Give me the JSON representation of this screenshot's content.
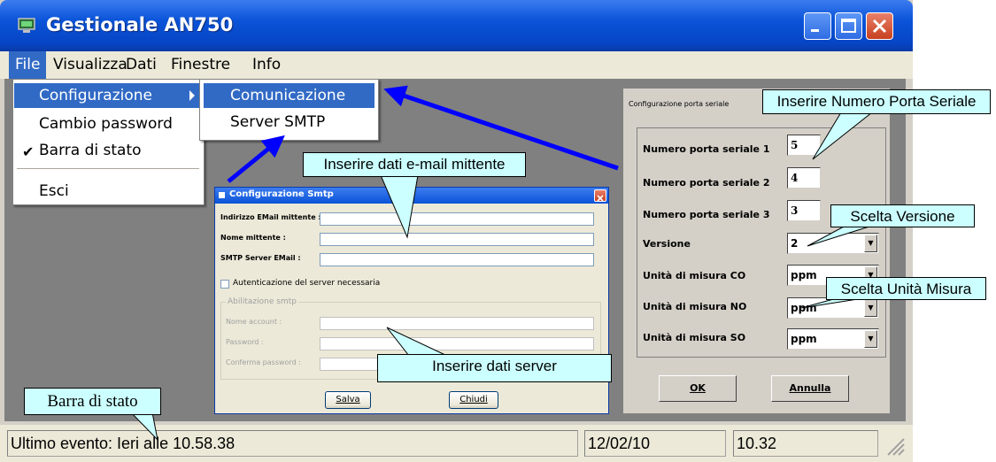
{
  "window": {
    "title": "Gestionale AN750"
  },
  "menubar": {
    "items": [
      "File",
      "Visualizza",
      "Dati",
      "Finestre",
      "Info"
    ]
  },
  "file_menu": {
    "items": [
      "Configurazione",
      "Cambio password",
      "Barra di stato",
      "Esci"
    ]
  },
  "config_submenu": {
    "items": [
      "Comunicazione",
      "Server SMTP"
    ]
  },
  "smtp_dialog": {
    "title": "Configurazione Smtp",
    "fields": [
      "Indirizzo EMail mittente :",
      "Nome mittente :",
      "SMTP Server EMail :"
    ],
    "auth_checkbox": "Autenticazione del server necessaria",
    "group_label": "Abilitazione smtp",
    "auth_fields": [
      "Nome account :",
      "Password :",
      "Conferma password :"
    ],
    "save_label": "Salva",
    "close_label": "Chiudi"
  },
  "serial_dialog": {
    "title": "Configurazione porta seriale",
    "rows": [
      {
        "label": "Numero porta seriale 1",
        "value": "5"
      },
      {
        "label": "Numero porta seriale 2",
        "value": "4"
      },
      {
        "label": "Numero porta seriale 3",
        "value": "3"
      },
      {
        "label": "Versione",
        "value": "2"
      },
      {
        "label": "Unità di misura CO",
        "value": "ppm"
      },
      {
        "label": "Unità di misura NO",
        "value": "ppm"
      },
      {
        "label": "Unità di misura SO",
        "value": "ppm"
      }
    ],
    "ok_label": "OK",
    "cancel_label": "Annulla"
  },
  "statusbar": {
    "event": "Ultimo evento: Ieri alle 10.58.38",
    "date": "12/02/10",
    "time": "10.32"
  },
  "callouts": {
    "serial_port": "Inserire Numero Porta Seriale",
    "email_sender": "Inserire dati e-mail mittente",
    "version": "Scelta Versione",
    "unit": "Scelta Unità Misura",
    "server_data": "Inserire dati server",
    "status_bar": "Barra di stato"
  },
  "colors": {
    "callout_fill": "#ccffff",
    "arrow": "#0000ff",
    "menu_highlight": "#316ac5",
    "client_area": "#808080"
  }
}
